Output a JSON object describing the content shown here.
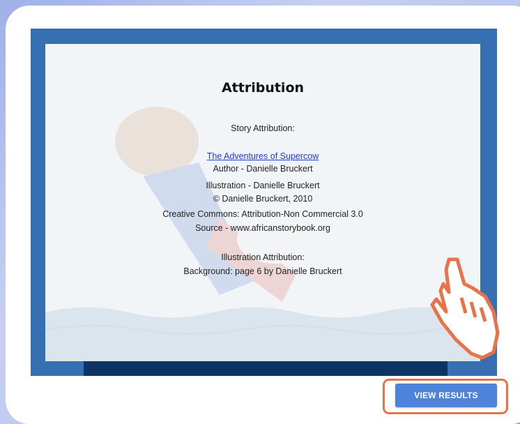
{
  "slide": {
    "title": "Attribution",
    "story_heading": "Story Attribution:",
    "story_link": "The Adventures of Supercow",
    "author": "Author - Danielle Bruckert",
    "illustration": "Illustration - Danielle Bruckert",
    "copyright": "© Danielle Bruckert, 2010",
    "license": "Creative Commons: Attribution-Non Commercial 3.0",
    "source": "Source - www.africanstorybook.org",
    "illustration_heading": "Illustration Attribution:",
    "background_credit": "Background: page 6 by Danielle Bruckert"
  },
  "actions": {
    "view_results_label": "VIEW RESULTS"
  },
  "icons": {
    "pointer": "pointing-hand-icon"
  },
  "colors": {
    "slide_frame": "#3670b3",
    "slide_bottom_bar": "#0c3566",
    "button": "#4f82d9",
    "highlight": "#e8734a",
    "link": "#1a3bd6"
  }
}
